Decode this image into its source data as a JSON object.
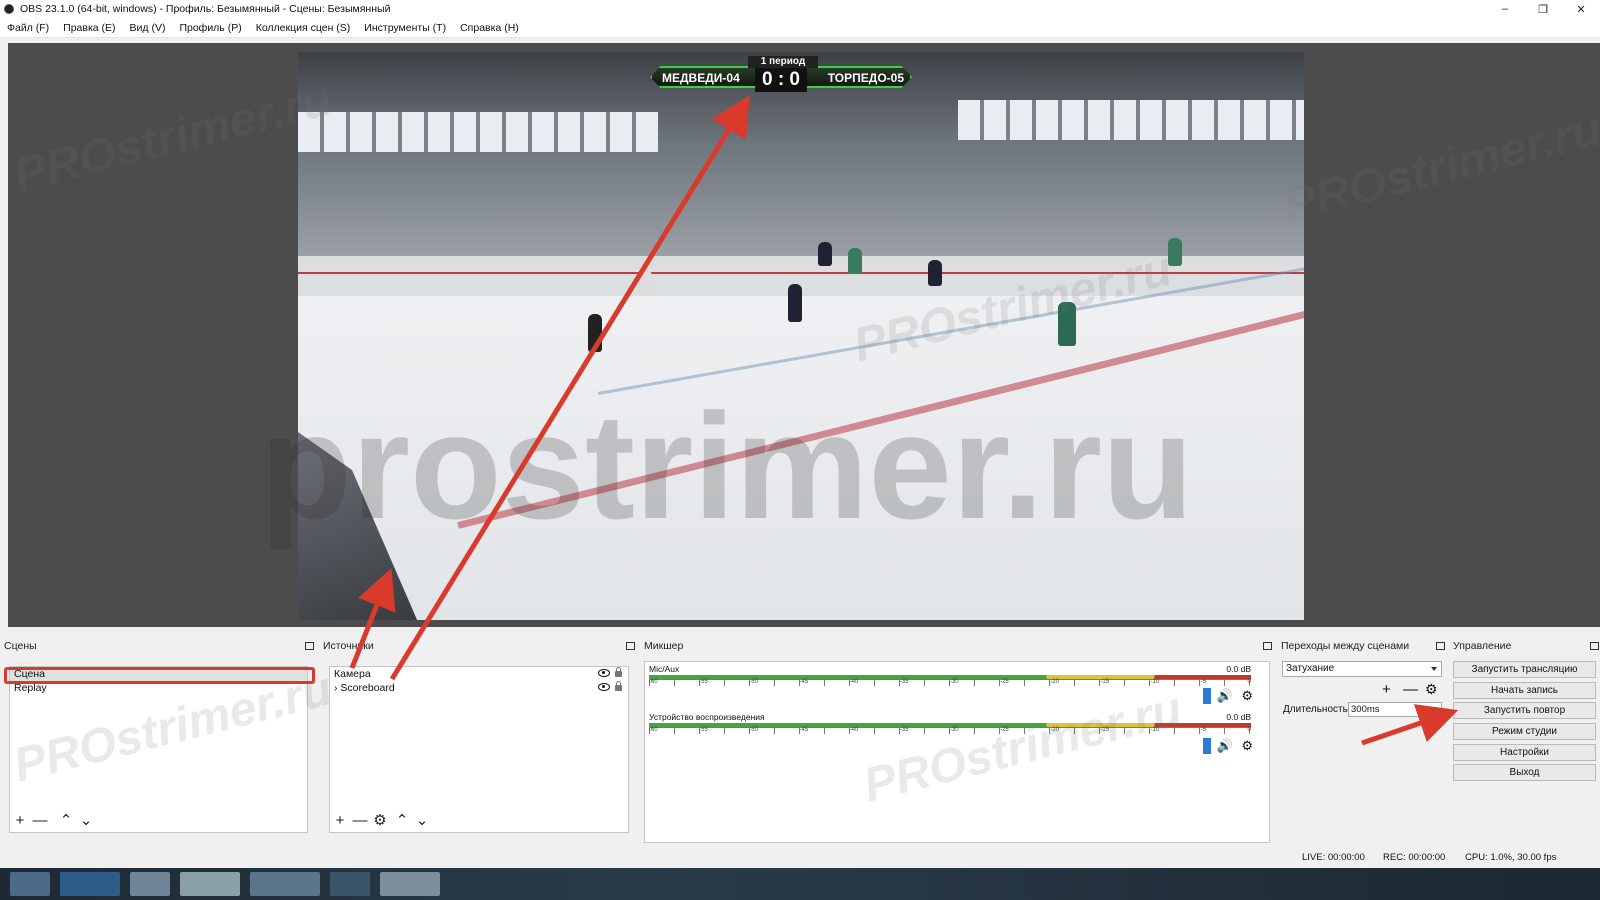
{
  "window": {
    "title": "OBS 23.1.0 (64-bit, windows) - Профиль: Безымянный - Сцены: Безымянный",
    "minimize": "–",
    "maximize": "❐",
    "close": "✕"
  },
  "menu": [
    "Файл (F)",
    "Правка (E)",
    "Вид (V)",
    "Профиль (P)",
    "Коллекция сцен (S)",
    "Инструменты (T)",
    "Справка (H)"
  ],
  "scoreboard": {
    "period": "1 период",
    "home": "МЕДВЕДИ-04",
    "away": "ТОРПЕДО-05",
    "score": "0 : 0",
    "accent": "#37d43c"
  },
  "scenes": {
    "title": "Сцены",
    "items": [
      "Сцена",
      "Replay"
    ],
    "selected": "Сцена"
  },
  "sources": {
    "title": "Источники",
    "items": [
      {
        "label": "Камера",
        "prefix": ""
      },
      {
        "label": "Scoreboard",
        "prefix": "›"
      }
    ]
  },
  "mixer": {
    "title": "Микшер",
    "tracks": [
      {
        "name": "Mic/Aux",
        "db": "0.0 dB"
      },
      {
        "name": "Устройство воспроизведения",
        "db": "0.0 dB"
      }
    ],
    "scale": [
      "-60",
      "-55",
      "-50",
      "-45",
      "-40",
      "-35",
      "-30",
      "-25",
      "-20",
      "-15",
      "-10",
      "-5",
      "0"
    ]
  },
  "transitions": {
    "title": "Переходы между сценами",
    "selected": "Затухание",
    "duration_label": "Длительность",
    "duration_value": "300ms"
  },
  "controls": {
    "title": "Управление",
    "buttons": [
      "Запустить трансляцию",
      "Начать запись",
      "Запустить повтор",
      "Режим студии",
      "Настройки",
      "Выход"
    ]
  },
  "status": {
    "live": "LIVE: 00:00:00",
    "rec": "REC: 00:00:00",
    "cpu": "CPU: 1.0%, 30.00 fps"
  },
  "watermark": {
    "big": "prostrimer.ru",
    "small": "PROstrimer.ru"
  },
  "annotation_color": "#d93a2b",
  "icons": {
    "plus": "+",
    "minus": "—",
    "up": "⌃",
    "down": "⌄",
    "gear": "⚙",
    "speaker": "🔊"
  }
}
